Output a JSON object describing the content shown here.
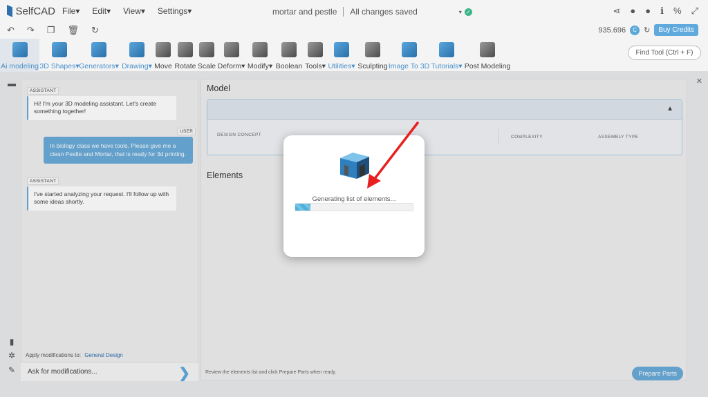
{
  "app": {
    "name": "SelfCAD"
  },
  "menu": [
    "File",
    "Edit",
    "View",
    "Settings"
  ],
  "document": {
    "title": "mortar and pestle",
    "status": "All changes saved"
  },
  "credits": {
    "amount": "935.696",
    "buy_label": "Buy Credits"
  },
  "toolbar": {
    "tools": [
      {
        "label": "Ai modeling",
        "style": "blue",
        "active": true
      },
      {
        "label": "3D Shapes",
        "style": "blue",
        "dropdown": true
      },
      {
        "label": "Generators",
        "style": "blue",
        "dropdown": true
      },
      {
        "label": "Drawing",
        "style": "blue",
        "dropdown": true
      },
      {
        "label": "Move"
      },
      {
        "label": "Rotate"
      },
      {
        "label": "Scale"
      },
      {
        "label": "Deform",
        "dropdown": true
      },
      {
        "label": "Modify",
        "dropdown": true
      },
      {
        "label": "Boolean"
      },
      {
        "label": "Tools",
        "dropdown": true
      },
      {
        "label": "Utilities",
        "style": "blue",
        "dropdown": true
      },
      {
        "label": "Sculpting"
      },
      {
        "label": "Image To 3D",
        "style": "blue"
      },
      {
        "label": "Tutorials",
        "style": "blue",
        "dropdown": true
      },
      {
        "label": "Post Modeling"
      }
    ],
    "find_tool_label": "Find Tool (Ctrl + F)"
  },
  "chat": {
    "messages": [
      {
        "role": "ASSISTANT",
        "text": "Hi! I'm your 3D modeling assistant. Let's create something together!"
      },
      {
        "role": "USER",
        "text": "In biology class we have tools. Please give me a clean Pestle and Mortar, that is ready for 3d printing."
      },
      {
        "role": "ASSISTANT",
        "text": "I've started analyzing your request. I'll follow up with some ideas shortly."
      }
    ],
    "apply_label": "Apply modifications to:",
    "apply_target": "General Design",
    "input_placeholder": "Ask for modifications..."
  },
  "model": {
    "title": "Model",
    "columns": [
      "DESIGN CONCEPT",
      "COMPLEXITY",
      "ASSEMBLY TYPE"
    ],
    "elements_title": "Elements",
    "review_text": "Review the elements list and click Prepare Parts when ready.",
    "prepare_label": "Prepare Parts"
  },
  "modal": {
    "text": "Generating list of elements...",
    "progress": 0.13
  },
  "colors": {
    "accent": "#5fa9dd",
    "annotation_arrow": "#e8201f"
  }
}
